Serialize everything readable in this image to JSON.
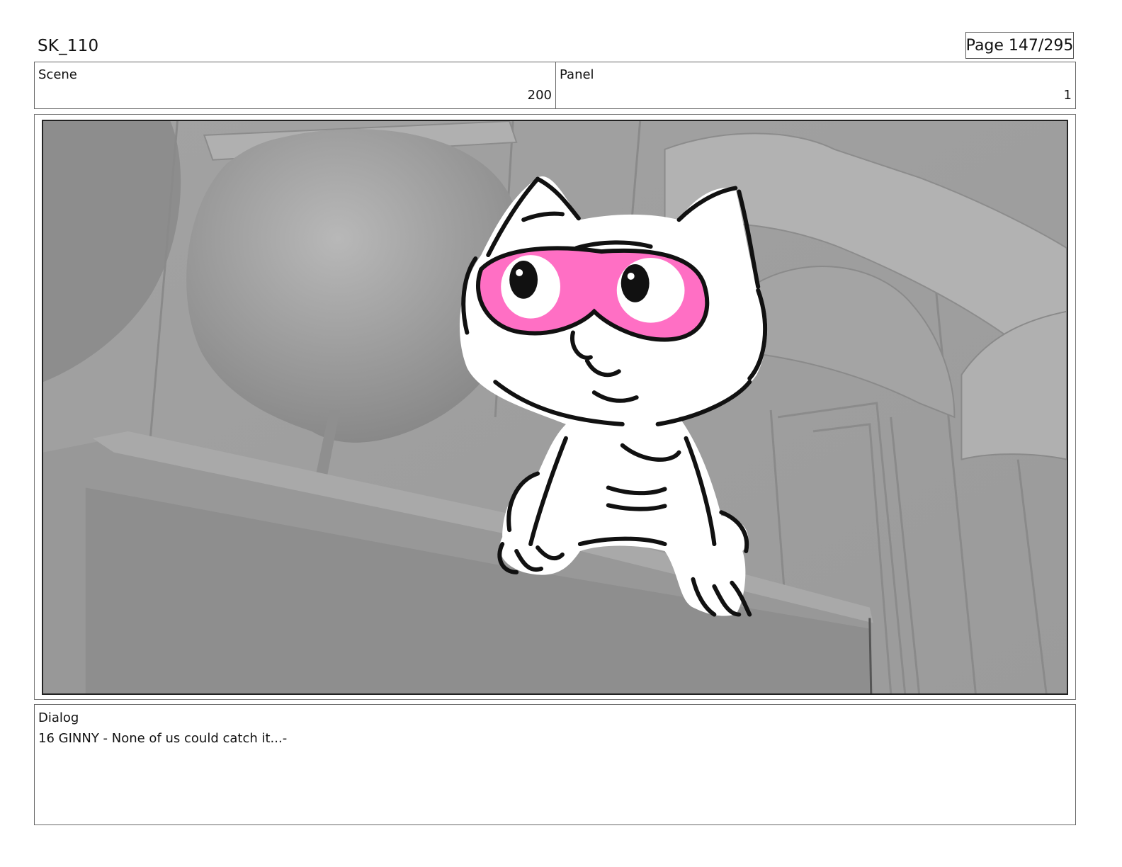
{
  "header": {
    "sequence": "SK_110",
    "page": "Page 147/295"
  },
  "info": {
    "scene_label": "Scene",
    "scene_value": "200",
    "panel_label": "Panel",
    "panel_value": "1"
  },
  "frame": {
    "image_name": "storyboard-panel-image"
  },
  "dialog": {
    "label": "Dialog",
    "text": "16 GINNY - None of us could catch it...-"
  },
  "colors": {
    "accent_pink": "#ff6fc4",
    "background_grey": "#a6a6a6"
  }
}
